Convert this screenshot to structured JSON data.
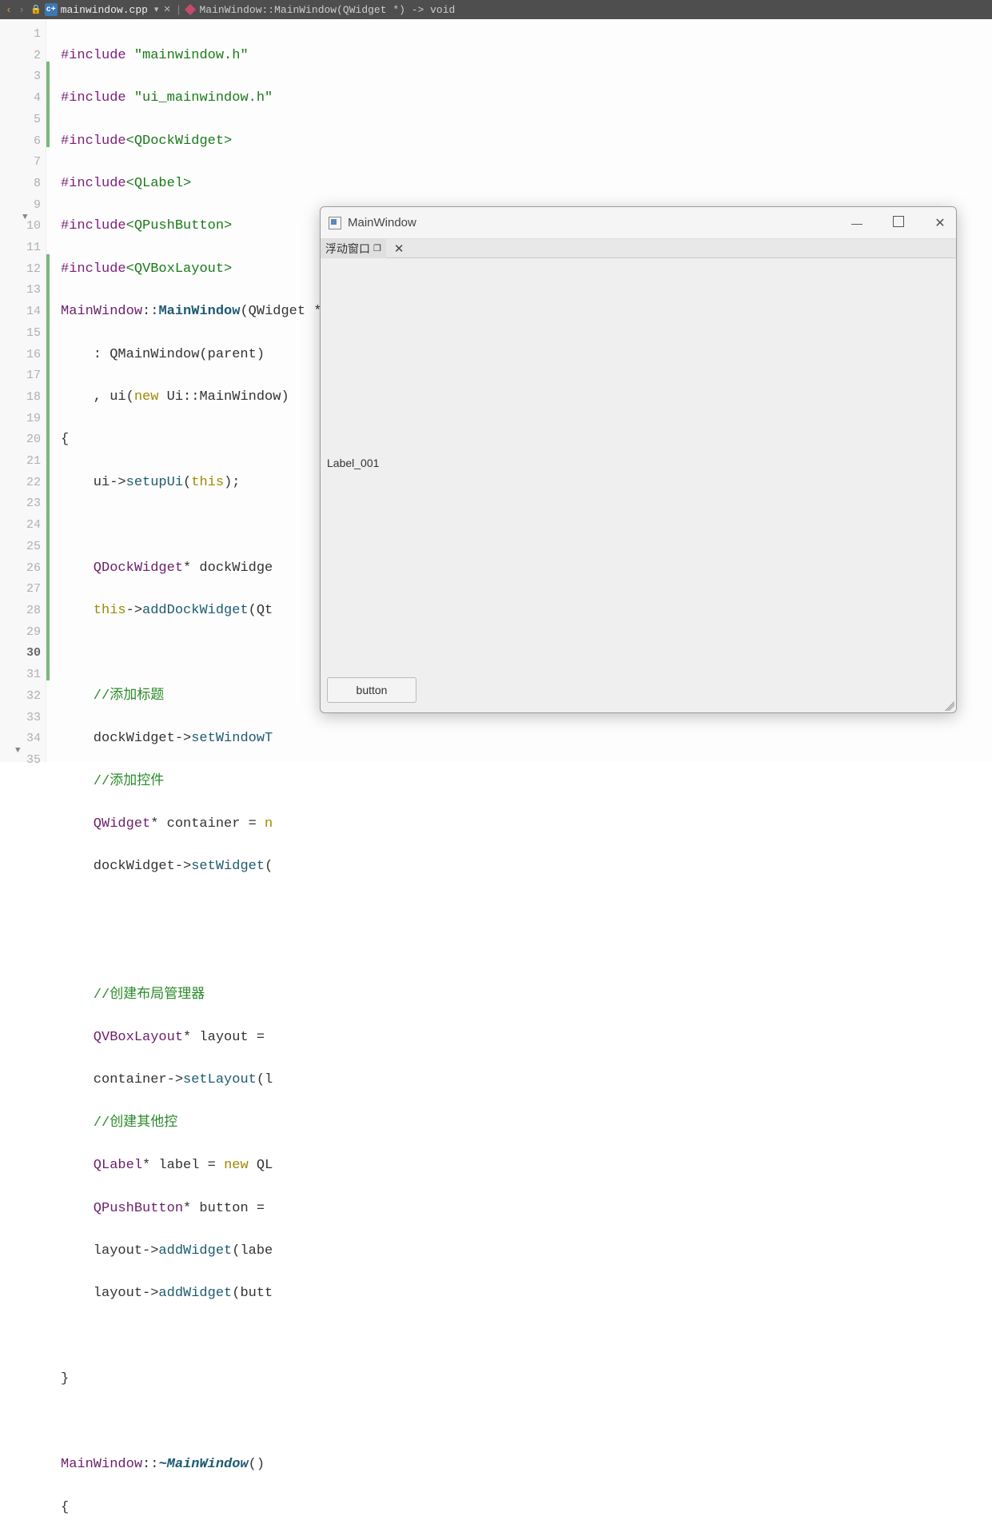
{
  "titlebar": {
    "filename": "mainwindow.cpp",
    "breadcrumb": "MainWindow::MainWindow(QWidget *) -> void"
  },
  "code": {
    "l1_inc": "#include",
    "l1_hdr": "\"mainwindow.h\"",
    "l2_inc": "#include",
    "l2_hdr": "\"ui_mainwindow.h\"",
    "l3_inc": "#include",
    "l3_hdr": "<QDockWidget>",
    "l4_inc": "#include",
    "l4_hdr": "<QLabel>",
    "l5_inc": "#include",
    "l5_hdr": "<QPushButton>",
    "l6_inc": "#include",
    "l6_hdr": "<QVBoxLayout>",
    "l7_cls": "MainWindow",
    "l7_sep": "::",
    "l7_ctor": "MainWindow",
    "l7_params": "(QWidget *parent)",
    "l8": "    : QMainWindow(parent)",
    "l9_pre": "    , ui(",
    "l9_new": "new",
    "l9_rest": " Ui::MainWindow)",
    "l10": "{",
    "l11_ui": "    ui->",
    "l11_m": "setupUi",
    "l11_args": "(",
    "l11_this": "this",
    "l11_end": ");",
    "l12": "",
    "l13_t": "    QDockWidget",
    "l13_rest": "* dockWidge",
    "l14_pre": "    ",
    "l14_this": "this",
    "l14_arrow": "->",
    "l14_m": "addDockWidget",
    "l14_args": "(Qt",
    "l15": "",
    "l16": "    //添加标题",
    "l17_pre": "    dockWidget->",
    "l17_m": "setWindowT",
    "l18": "    //添加控件",
    "l19_t": "    QWidget",
    "l19_rest": "* container = ",
    "l19_new": "n",
    "l20_pre": "    dockWidget->",
    "l20_m": "setWidget",
    "l20_args": "(",
    "l21": "",
    "l22": "",
    "l23": "    //创建布局管理器",
    "l24_t": "    QVBoxLayout",
    "l24_rest": "* layout = ",
    "l25_pre": "    container->",
    "l25_m": "setLayout",
    "l25_args": "(l",
    "l26": "    //创建其他控",
    "l27_t": "    QLabel",
    "l27_rest": "* label = ",
    "l27_new": "new",
    "l27_end": " QL",
    "l28_t": "    QPushButton",
    "l28_rest": "* button = ",
    "l29_pre": "    layout->",
    "l29_m": "addWidget",
    "l29_args": "(labe",
    "l30_pre": "    layout->",
    "l30_m": "addWidget",
    "l30_args": "(butt",
    "l31": "",
    "l32": "}",
    "l33": "",
    "l34_cls": "MainWindow",
    "l34_sep": "::",
    "l34_dtor": "~MainWindow",
    "l34_end": "()",
    "l35": "{"
  },
  "lines": [
    "1",
    "2",
    "3",
    "4",
    "5",
    "6",
    "7",
    "8",
    "9",
    "10",
    "11",
    "12",
    "13",
    "14",
    "15",
    "16",
    "17",
    "18",
    "19",
    "20",
    "21",
    "22",
    "23",
    "24",
    "25",
    "26",
    "27",
    "28",
    "29",
    "30",
    "31",
    "32",
    "33",
    "34",
    "35"
  ],
  "qt": {
    "title": "MainWindow",
    "dock_title": "浮动窗口",
    "label": "Label_001",
    "button": "button"
  }
}
